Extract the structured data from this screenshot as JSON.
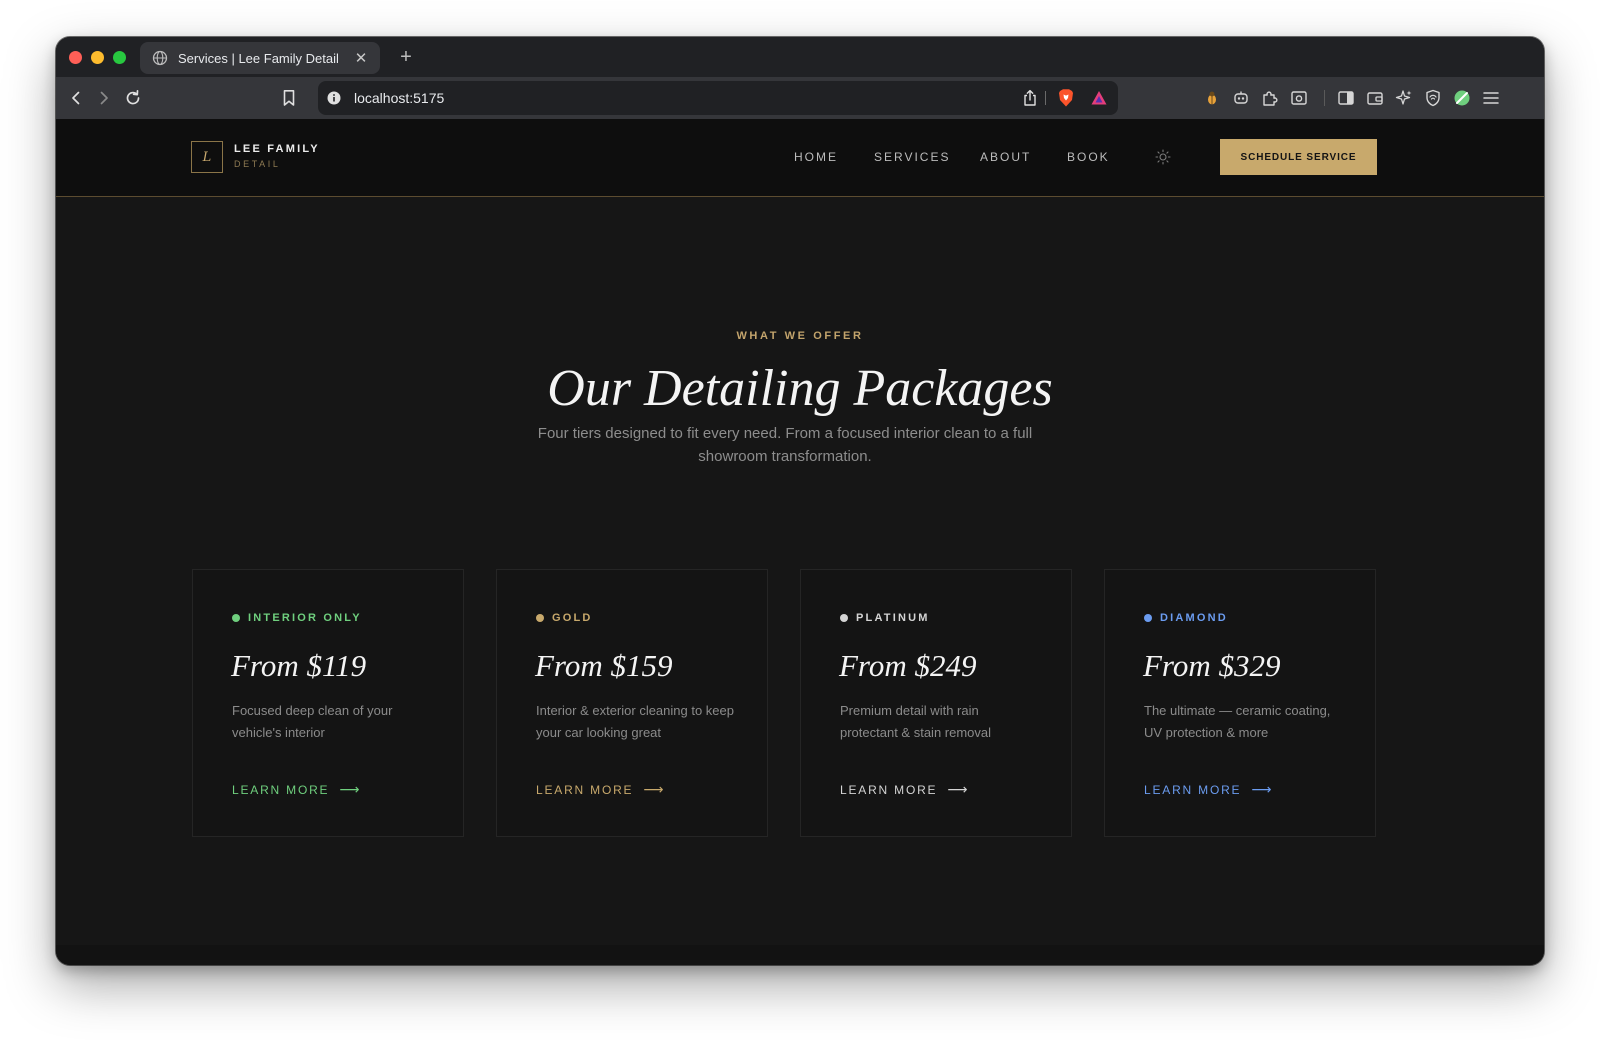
{
  "browser": {
    "tab_title": "Services | Lee Family Detail",
    "url": "localhost:5175"
  },
  "site": {
    "logo_letter": "L",
    "brand_name": "LEE FAMILY",
    "brand_sub": "DETAIL",
    "nav": [
      {
        "label": "HOME"
      },
      {
        "label": "SERVICES"
      },
      {
        "label": "ABOUT"
      },
      {
        "label": "BOOK"
      }
    ],
    "cta_label": "SCHEDULE SERVICE",
    "accent_color": "#c8a96c"
  },
  "hero": {
    "eyebrow": "WHAT WE OFFER",
    "title": "Our Detailing Packages",
    "subtitle": "Four tiers designed to fit every need. From a focused interior clean to a full showroom transformation."
  },
  "packages": [
    {
      "tier": "INTERIOR ONLY",
      "color": "#6fcf7e",
      "price": "From $119",
      "description": "Focused deep clean of your vehicle's interior",
      "link": "LEARN MORE"
    },
    {
      "tier": "GOLD",
      "color": "#c8a96c",
      "price": "From $159",
      "description": "Interior & exterior cleaning to keep your car looking great",
      "link": "LEARN MORE"
    },
    {
      "tier": "PLATINUM",
      "color": "#d4d4d4",
      "price": "From $249",
      "description": "Premium detail with rain protectant & stain removal",
      "link": "LEARN MORE"
    },
    {
      "tier": "DIAMOND",
      "color": "#6b9cf0",
      "price": "From $329",
      "description": "The ultimate — ceramic coating, UV protection & more",
      "link": "LEARN MORE"
    }
  ]
}
